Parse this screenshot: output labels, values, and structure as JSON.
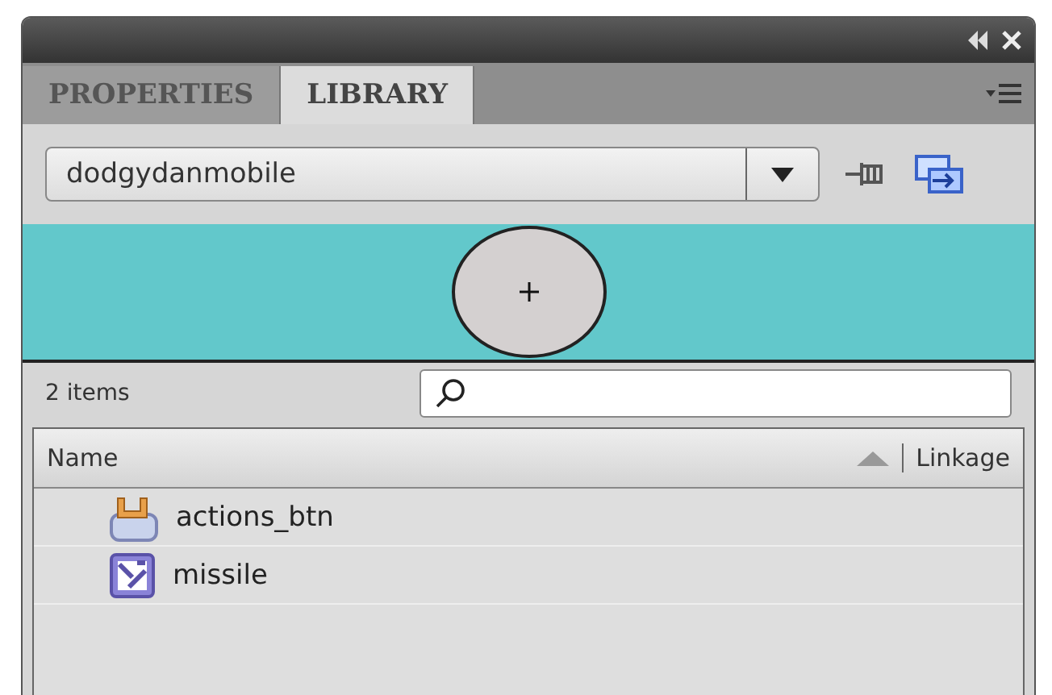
{
  "tabs": [
    {
      "label": "PROPERTIES",
      "selected": false
    },
    {
      "label": "LIBRARY",
      "selected": true
    }
  ],
  "library_dropdown": {
    "value": "dodgydanmobile"
  },
  "item_count": "2 items",
  "table": {
    "columns": [
      "Name",
      "Linkage"
    ],
    "rows": [
      {
        "name": "actions_btn",
        "kind": "button"
      },
      {
        "name": "missile",
        "kind": "movieclip"
      }
    ]
  }
}
